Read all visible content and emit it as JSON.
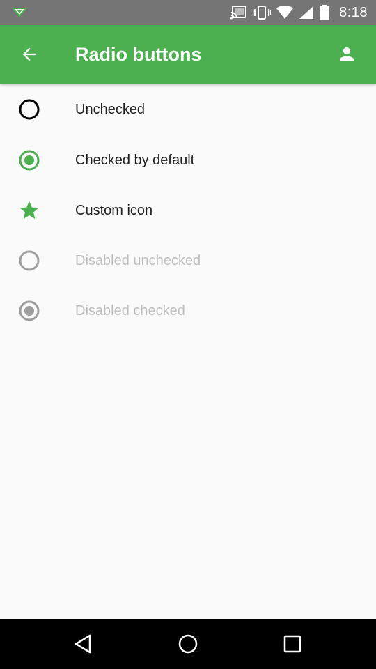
{
  "status_bar": {
    "time": "8:18",
    "icons": [
      "notification-app-icon",
      "cast-icon",
      "vibrate-icon",
      "wifi-icon",
      "cell-signal-icon",
      "battery-icon"
    ]
  },
  "app_bar": {
    "title": "Radio buttons",
    "back_icon": "arrow-back-icon",
    "account_icon": "person-icon",
    "color": "#4caf50"
  },
  "radio_buttons": [
    {
      "label": "Unchecked",
      "checked": false,
      "enabled": true,
      "icon": "radio-unchecked-icon"
    },
    {
      "label": "Checked by default",
      "checked": true,
      "enabled": true,
      "icon": "radio-checked-icon"
    },
    {
      "label": "Custom icon",
      "checked": false,
      "enabled": true,
      "icon": "star-icon"
    },
    {
      "label": "Disabled unchecked",
      "checked": false,
      "enabled": false,
      "icon": "radio-unchecked-icon"
    },
    {
      "label": "Disabled checked",
      "checked": true,
      "enabled": false,
      "icon": "radio-checked-icon"
    }
  ],
  "colors": {
    "accent": "#4caf50",
    "status_bar": "#757575",
    "text_primary": "#212121",
    "text_disabled": "#bdbdbd",
    "disabled_control": "#9e9e9e",
    "background": "#fafafa"
  },
  "nav_bar": {
    "buttons": [
      "back-triangle-icon",
      "home-circle-icon",
      "recents-square-icon"
    ]
  }
}
